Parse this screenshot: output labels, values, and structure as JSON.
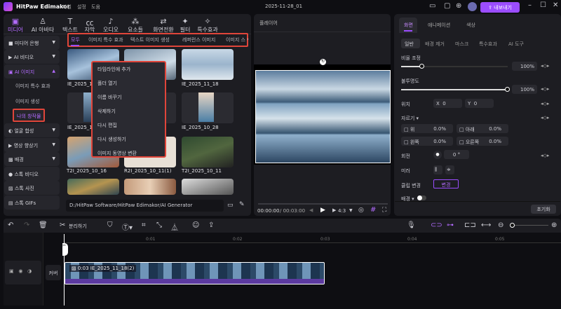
{
  "app": {
    "title": "HitPaw Edimakor",
    "menu": [
      "파일",
      "설정",
      "도움"
    ],
    "project": "2025-11-28_01",
    "export_label": "내보내기",
    "accent": "#9b4dff"
  },
  "toolbar": [
    {
      "label": "미디어",
      "icon": "media-icon",
      "active": true
    },
    {
      "label": "AI 아바타",
      "icon": "avatar-icon"
    },
    {
      "label": "텍스트",
      "icon": "text-icon"
    },
    {
      "label": "자막",
      "icon": "caption-icon"
    },
    {
      "label": "오디오",
      "icon": "music-icon"
    },
    {
      "label": "요소들",
      "icon": "elements-icon"
    },
    {
      "label": "화면전환",
      "icon": "transition-icon"
    },
    {
      "label": "필터",
      "icon": "filter-icon"
    },
    {
      "label": "특수효과",
      "icon": "effects-icon"
    }
  ],
  "sidebar": {
    "items": [
      {
        "label": "미디어 은행"
      },
      {
        "label": "AI 비디오"
      },
      {
        "label": "AI 이미지"
      },
      {
        "label": "얼굴 합성"
      },
      {
        "label": "영상 향상기"
      },
      {
        "label": "배경"
      },
      {
        "label": "스톡 비디오"
      },
      {
        "label": "스톡 사진"
      },
      {
        "label": "스톡 GIFs"
      }
    ],
    "subitems": [
      "이미지 특수 효과",
      "이미지 생성",
      "나의 창작물"
    ]
  },
  "media": {
    "tabs": [
      "모두",
      "이미지 특수 효과",
      "텍스트 이미지 생성",
      "레퍼런스 이미지",
      "이미지 스"
    ],
    "items": [
      {
        "name": "IE_2025_11_"
      },
      {
        "name": ""
      },
      {
        "name": "IE_2025_11_18"
      },
      {
        "name": "IE_2025_11_"
      },
      {
        "name": ""
      },
      {
        "name": "IE_2025_10_28"
      },
      {
        "name": "T2I_2025_10_16"
      },
      {
        "name": "R2I_2025_10_11(1)"
      },
      {
        "name": "T2I_2025_10_11"
      }
    ],
    "path": "D:/HitPaw Software/HitPaw Edimakor/AI Generator"
  },
  "context_menu": [
    "타임라인에 추가",
    "폴더 열기",
    "이름 바꾸기",
    "삭제하기",
    "다시 편집",
    "다시 생성하기",
    "이미지 동영상 변환"
  ],
  "player": {
    "title": "플레이어",
    "current_time": "00:00:00",
    "total_time": "/ 00:03:00",
    "ratio": "4:3"
  },
  "properties": {
    "tabs": [
      "화면",
      "애니메이션",
      "색상"
    ],
    "subtabs": [
      "일반",
      "배경 제거",
      "마스크",
      "특수효과",
      "AI 도구"
    ],
    "scale_label": "비율 조정",
    "scale_value": "100%",
    "scale": 0.2,
    "opacity_label": "불투명도",
    "opacity_value": "100%",
    "opacity": 1.0,
    "position_label": "위치",
    "x_label": "X",
    "x": "0",
    "y_label": "Y",
    "y": "0",
    "crop_label": "자르기",
    "crop": [
      {
        "label": "위",
        "value": "0.0%"
      },
      {
        "label": "아래",
        "value": "0.0%"
      },
      {
        "label": "왼쪽",
        "value": "0.0%"
      },
      {
        "label": "오른쪽",
        "value": "0.0%"
      }
    ],
    "rotate_label": "회전",
    "rotate_value": "0",
    "rotate_unit": "°",
    "mirror_label": "미러",
    "clip_change_label": "클립 변경",
    "change_button": "변경",
    "background_label": "배경",
    "reset_label": "초기화"
  },
  "timeline": {
    "split_label": "분리하기",
    "ticks": [
      "0:01",
      "0:02",
      "0:03",
      "0:04",
      "0:05"
    ],
    "cover_label": "커버",
    "clip_label": "0:03 IE_2025_11_18(2)"
  }
}
